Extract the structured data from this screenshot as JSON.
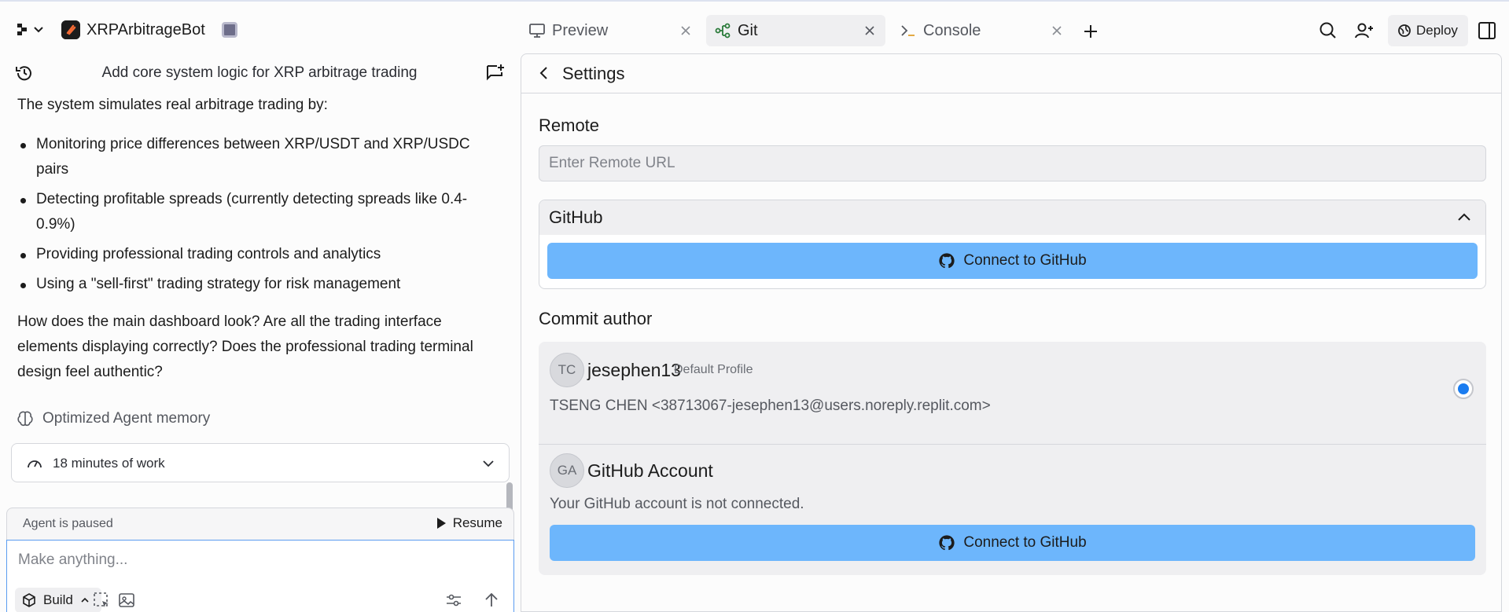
{
  "app": {
    "name": "XRPArbitrageBot"
  },
  "tabs": [
    {
      "label": "Preview",
      "icon": "monitor-icon",
      "active": false
    },
    {
      "label": "Git",
      "icon": "git-branch-icon",
      "active": true
    },
    {
      "label": "Console",
      "icon": "terminal-icon",
      "active": false
    }
  ],
  "toolbar": {
    "deploy_label": "Deploy"
  },
  "chat": {
    "title": "Add core system logic for XRP arbitrage trading",
    "intro": "The system simulates real arbitrage trading by:",
    "bullets": [
      "Monitoring price differences between XRP/USDT and XRP/USDC pairs",
      "Detecting profitable spreads (currently detecting spreads like 0.4-0.9%)",
      "Providing professional trading controls and analytics",
      "Using a \"sell-first\" trading strategy for risk management"
    ],
    "question": "How does the main dashboard look? Are all the trading interface elements displaying correctly? Does the professional trading terminal design feel authentic?",
    "memory_label": "Optimized Agent memory",
    "work_label": "18 minutes of work",
    "paused_label": "Agent is paused",
    "resume_label": "Resume",
    "input_placeholder": "Make anything...",
    "build_label": "Build"
  },
  "settings": {
    "title": "Settings",
    "remote_label": "Remote",
    "remote_placeholder": "Enter Remote URL",
    "github_label": "GitHub",
    "connect_label": "Connect to GitHub",
    "commit_author_label": "Commit author",
    "authors": [
      {
        "initials": "TC",
        "name": "jesephen13",
        "badge": "Default Profile",
        "detail": "TSENG CHEN <38713067-jesephen13@users.noreply.replit.com>",
        "selected": true
      },
      {
        "initials": "GA",
        "name": "GitHub Account",
        "detail": "Your GitHub account is not connected.",
        "connect_label": "Connect to GitHub"
      }
    ]
  },
  "colors": {
    "accent_button": "#6db6fc",
    "radio_selected": "#1a7cf0",
    "panel_gray": "#efeff1"
  }
}
